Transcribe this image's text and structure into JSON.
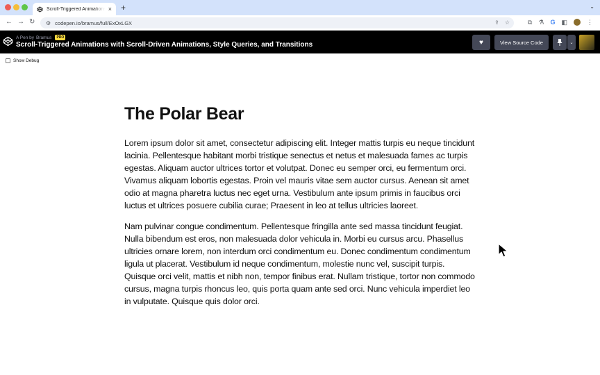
{
  "browser": {
    "tab_title": "Scroll-Triggered Animations with",
    "tab_close": "×",
    "new_tab": "+",
    "url": "codepen.io/bramus/full/ExOxLGX",
    "nav": {
      "back": "←",
      "forward": "→",
      "reload": "↻"
    }
  },
  "codepen": {
    "by_prefix": "A Pen by",
    "author": "Bramus",
    "pro_badge": "PRO",
    "title": "Scroll-Triggered Animations with Scroll-Driven Animations, Style Queries, and Transitions",
    "heart": "♥",
    "view_source_label": "View Source Code",
    "pin": "📌",
    "caret": "⌄"
  },
  "page": {
    "debug_label": "Show Debug",
    "heading": "The Polar Bear",
    "paragraphs": [
      "Lorem ipsum dolor sit amet, consectetur adipiscing elit. Integer mattis turpis eu neque tincidunt lacinia. Pellentesque habitant morbi tristique senectus et netus et malesuada fames ac turpis egestas. Aliquam auctor ultrices tortor et volutpat. Donec eu semper orci, eu fermentum orci. Vivamus aliquam lobortis egestas. Proin vel mauris vitae sem auctor cursus. Aenean sit amet odio at magna pharetra luctus nec eget urna. Vestibulum ante ipsum primis in faucibus orci luctus et ultrices posuere cubilia curae; Praesent in leo at tellus ultricies laoreet.",
      "Nam pulvinar congue condimentum. Pellentesque fringilla ante sed massa tincidunt feugiat. Nulla bibendum est eros, non malesuada dolor vehicula in. Morbi eu cursus arcu. Phasellus ultricies ornare lorem, non interdum orci condimentum eu. Donec condimentum condimentum ligula ut placerat. Vestibulum id neque condimentum, molestie nunc vel, suscipit turpis. Quisque orci velit, mattis et nibh non, tempor finibus erat. Nullam tristique, tortor non commodo cursus, magna turpis rhoncus leo, quis porta quam ante sed orci. Nunc vehicula imperdiet leo in vulputate. Quisque quis dolor orci."
    ]
  },
  "icons": {
    "tab_favicon": "codepen-icon",
    "header_logo": "codepen-logo-icon",
    "cursor": "mouse-pointer-icon"
  },
  "colors": {
    "tabbar": "#d3e2fb",
    "header_bg": "#000000",
    "button_bg": "#444857",
    "pro_badge": "#ffdd40"
  }
}
